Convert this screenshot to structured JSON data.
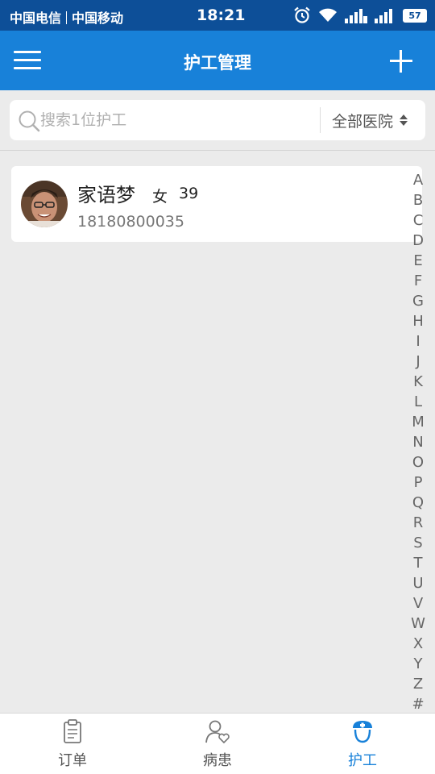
{
  "status_bar": {
    "carrier1": "中国电信",
    "carrier2": "中国移动",
    "time": "18:21",
    "battery": "57"
  },
  "header": {
    "title": "护工管理",
    "menu_icon": "hamburger-menu-icon",
    "add_icon": "plus-icon"
  },
  "search": {
    "placeholder": "搜索1位护工",
    "value": "",
    "hospital_filter": "全部医院"
  },
  "nurses": [
    {
      "name": "家语梦",
      "gender": "女",
      "age": "39",
      "phone": "18180800035"
    }
  ],
  "alpha_index": [
    "A",
    "B",
    "C",
    "D",
    "E",
    "F",
    "G",
    "H",
    "I",
    "J",
    "K",
    "L",
    "M",
    "N",
    "O",
    "P",
    "Q",
    "R",
    "S",
    "T",
    "U",
    "V",
    "W",
    "X",
    "Y",
    "Z",
    "#"
  ],
  "bottom_nav": {
    "items": [
      {
        "label": "订单",
        "icon": "clipboard-icon",
        "active": false
      },
      {
        "label": "病患",
        "icon": "patient-icon",
        "active": false
      },
      {
        "label": "护工",
        "icon": "nurse-icon",
        "active": true
      }
    ]
  },
  "colors": {
    "status_bar": "#0d4f98",
    "header": "#1881d9",
    "background": "#ebebeb",
    "active_nav": "#1881d9"
  }
}
